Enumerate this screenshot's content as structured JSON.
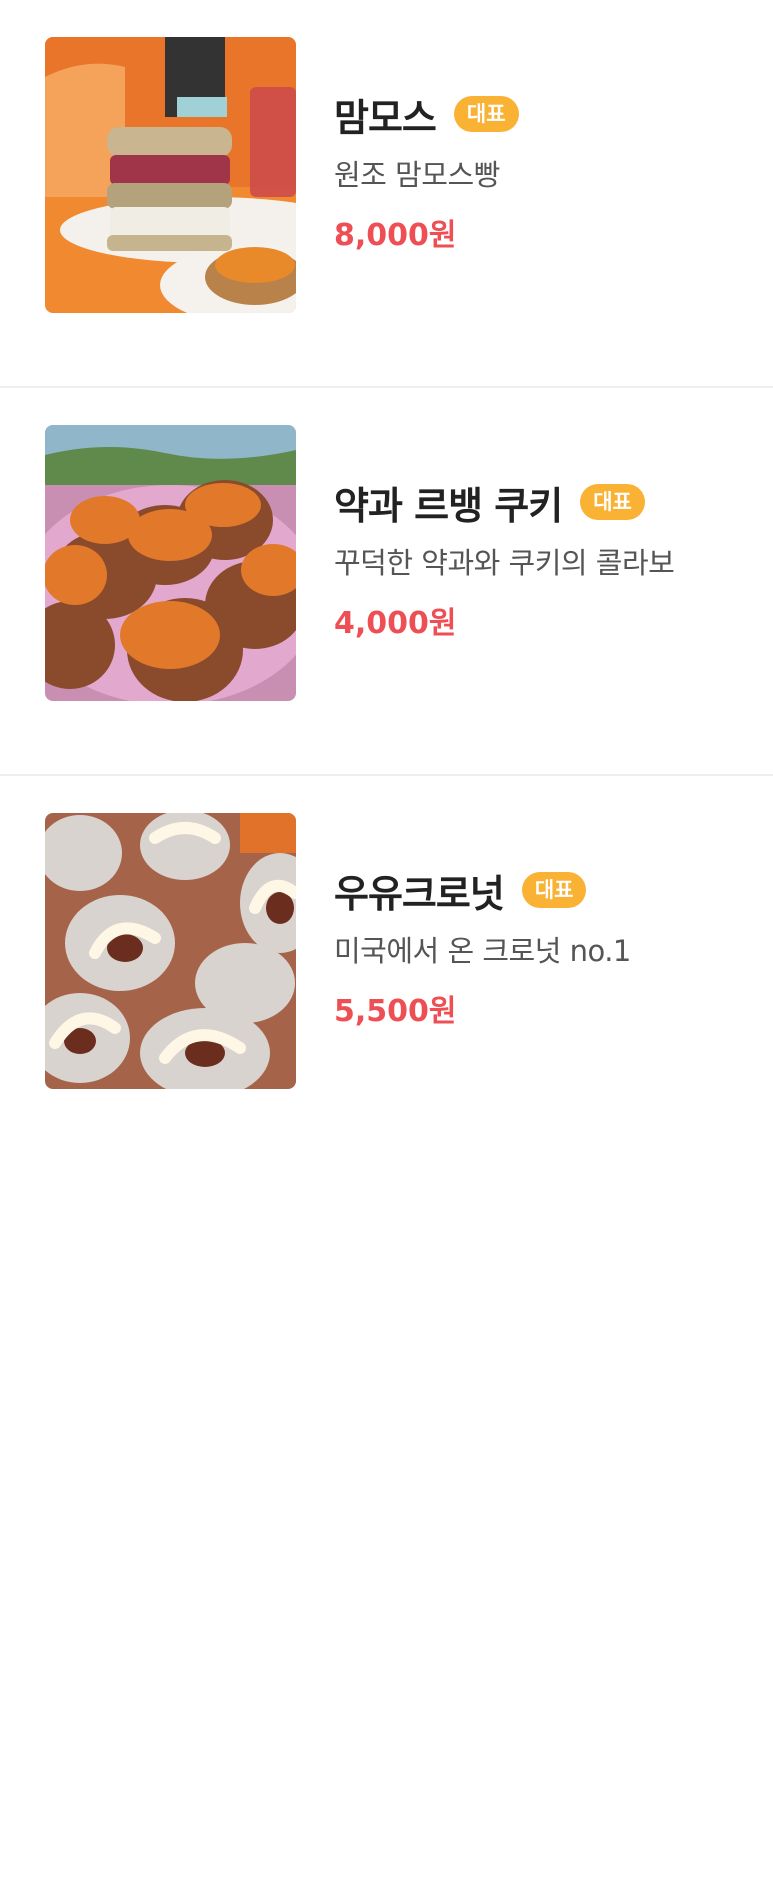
{
  "colors": {
    "badge": "#f9b233",
    "price": "#ee4f55",
    "divider": "#eeeef2"
  },
  "menu": {
    "items": [
      {
        "name": "맘모스",
        "badge": "대표",
        "description": "원조 맘모스빵",
        "price": "8,000원",
        "image": "mammoth-bread-sandwich-photo"
      },
      {
        "name": "약과 르뱅 쿠키",
        "badge": "대표",
        "description": "꾸덕한 약과와 쿠키의 콜라보",
        "price": "4,000원",
        "image": "yakgwa-levain-cookies-photo"
      },
      {
        "name": "우유크로넛",
        "badge": "대표",
        "description": "미국에서 온 크로넛 no.1",
        "price": "5,500원",
        "image": "milk-cronut-photo"
      }
    ]
  }
}
